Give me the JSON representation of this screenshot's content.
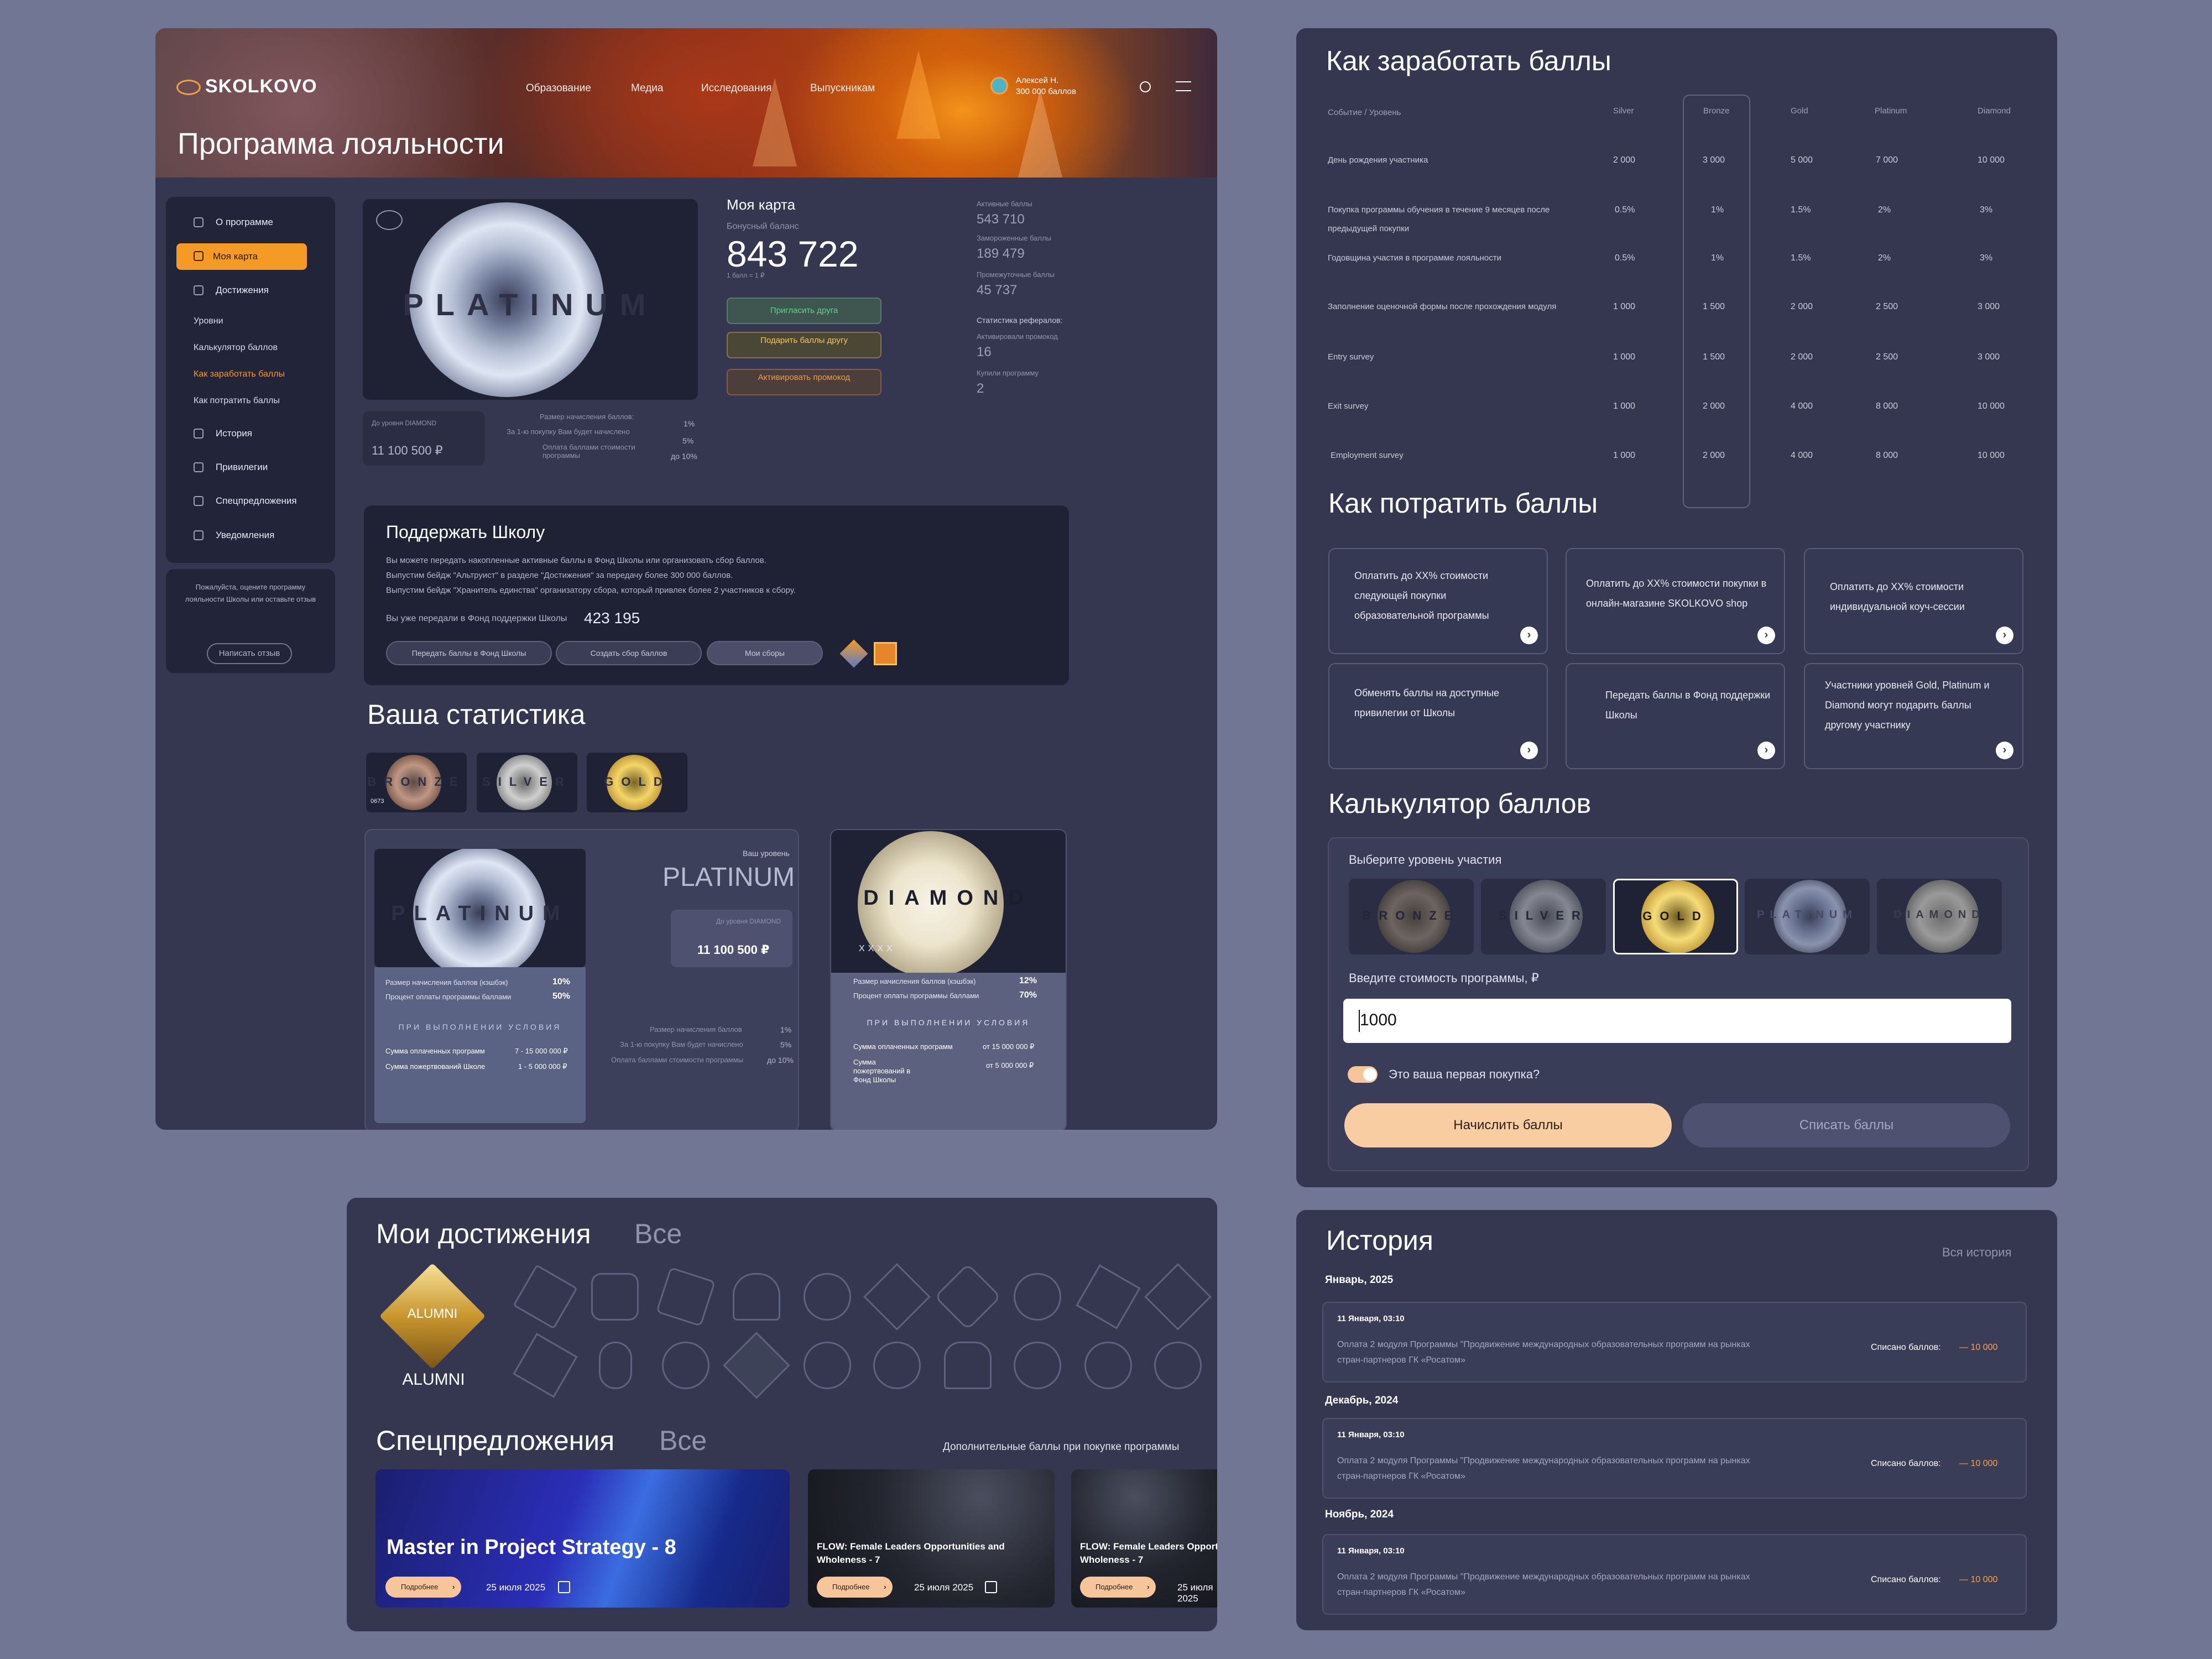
{
  "header": {
    "logo": "SKOLKOVO",
    "nav": [
      "Образование",
      "Медиа",
      "Исследования",
      "Выпускникам"
    ],
    "user_name": "Алексей Н.",
    "user_points": "300 000 баллов",
    "page_title": "Программа лояльности"
  },
  "sidebar": {
    "items": [
      "О программе",
      "Моя карта",
      "Достижения"
    ],
    "sub_items": [
      "Уровни",
      "Калькулятор баллов",
      "Как заработать баллы",
      "Как потратить баллы"
    ],
    "items2": [
      "История",
      "Привилегии",
      "Спецпредложения",
      "Уведомления"
    ],
    "feedback_text": "Пожалуйста, оцените программу лояльности Школы или оставьте отзыв",
    "feedback_button": "Написать отзыв"
  },
  "card": {
    "tier_word": "PLATINUM",
    "to_level_label": "До уровня DIAMOND",
    "to_level_value": "11 100 500 ₽",
    "rate_labels": [
      "Размер начисления баллов:",
      "За 1-ю покупку Вам будет начислено",
      "Оплата баллами стоимости программы"
    ],
    "rate_values": [
      "1%",
      "5%",
      "до 10%"
    ]
  },
  "my_card": {
    "title": "Моя карта",
    "balance_label": "Бонусный баланс",
    "balance": "843 722",
    "rate_note": "1 балл = 1 ₽",
    "btn_invite": "Пригласить друга",
    "btn_gift": "Подарить баллы другу",
    "btn_promo": "Активировать промокод",
    "active_label": "Активные баллы",
    "active_value": "543 710",
    "frozen_label": "Замороженные баллы",
    "frozen_value": "189 479",
    "expire_label": "Промежуточные баллы",
    "expire_value": "45 737",
    "ref_title": "Статистика рефералов:",
    "ref_promo_label": "Активировали промокод",
    "ref_promo_value": "16",
    "ref_bought_label": "Купили программу",
    "ref_bought_value": "2"
  },
  "support": {
    "title": "Поддержать Школу",
    "lines": [
      "Вы можете передать накопленные активные баллы в Фонд Школы или организовать сбор баллов.",
      "Выпустим бейдж \"Альтруист\" в разделе \"Достижения\" за передачу более 300 000 баллов.",
      "Выпустим бейдж \"Хранитель единства\" организатору сбора, который привлек более 2 участников к сбору."
    ],
    "transferred_label": "Вы уже передали в Фонд поддержки Школы",
    "transferred_value": "423 195",
    "btn_transfer": "Передать баллы в Фонд Школы",
    "btn_create": "Создать сбор баллов",
    "btn_my": "Мои сборы"
  },
  "stats": {
    "title": "Ваша статистика",
    "badges": [
      "BRONZE",
      "SILVER",
      "GOLD"
    ],
    "badge_number": "0673",
    "platinum_word": "PLATINUM",
    "diamond_word": "DIAMOND",
    "your_level_label": "Ваш уровень",
    "your_level": "PLATINUM",
    "to_level_label": "До уровня DIAMOND",
    "to_level_value": "11 100 500 ₽",
    "plat_rate_labels": [
      "Размер начисления баллов (кэшбэк)",
      "Процент оплаты программы баллами"
    ],
    "plat_rate_values": [
      "10%",
      "50%"
    ],
    "cond_title": "ПРИ ВЫПОЛНЕНИИ УСЛОВИЯ",
    "plat_cond_labels": [
      "Сумма оплаченных программ",
      "Сумма пожертвований Школе"
    ],
    "plat_cond_values": [
      "7 - 15 000 000 ₽",
      "1 - 5 000 000 ₽"
    ],
    "mid_labels": [
      "Размер начисления баллов",
      "За 1-ю покупку Вам будет начислено",
      "Оплата баллами стоимости программы"
    ],
    "mid_values": [
      "1%",
      "5%",
      "до 10%"
    ],
    "dia_number": "XXXX",
    "dia_rate_values": [
      "12%",
      "70%"
    ],
    "dia_cond_labels": [
      "Сумма оплаченных программ",
      "Сумма пожертвований в Фонд Школы"
    ],
    "dia_cond_values": [
      "от 15 000 000 ₽",
      "от 5 000 000 ₽"
    ]
  },
  "earn": {
    "title": "Как заработать баллы",
    "headers": [
      "Событие / Уровень",
      "Silver",
      "Bronze",
      "Gold",
      "Platinum",
      "Diamond"
    ],
    "rows": [
      {
        "label": "День рождения участника",
        "values": [
          "2 000",
          "3 000",
          "5 000",
          "7 000",
          "10 000"
        ]
      },
      {
        "label": "Покупка программы обучения в течение 9 месяцев после предыдущей покупки",
        "values": [
          "0.5%",
          "1%",
          "1.5%",
          "2%",
          "3%"
        ]
      },
      {
        "label": "Годовщина участия в программе лояльности",
        "values": [
          "0.5%",
          "1%",
          "1.5%",
          "2%",
          "3%"
        ]
      },
      {
        "label": "Заполнение оценочной формы после прохождения модуля",
        "values": [
          "1 000",
          "1 500",
          "2 000",
          "2 500",
          "3 000"
        ]
      },
      {
        "label": "Entry survey",
        "values": [
          "1 000",
          "1 500",
          "2 000",
          "2 500",
          "3 000"
        ]
      },
      {
        "label": "Exit survey",
        "values": [
          "1 000",
          "2 000",
          "4 000",
          "8 000",
          "10 000"
        ]
      },
      {
        "label": "Employment survey",
        "values": [
          "1 000",
          "2 000",
          "4 000",
          "8 000",
          "10 000"
        ]
      }
    ]
  },
  "spend": {
    "title": "Как потратить баллы",
    "cards": [
      "Оплатить до XX% стоимости следующей покупки образовательной программы",
      "Оплатить до XX% стоимости покупки в онлайн-магазине SKOLKOVO shop",
      "Оплатить до XX% стоимости индивидуальной коуч-сессии",
      "Обменять баллы на доступные привилегии от Школы",
      "Передать баллы в Фонд поддержки Школы",
      "Участники уровней Gold, Platinum и Diamond могут подарить баллы другому участнику"
    ]
  },
  "calculator": {
    "title": "Калькулятор баллов",
    "level_label": "Выберите уровень участия",
    "levels": [
      "BRONZE",
      "SILVER",
      "GOLD",
      "PLATINUM",
      "DIAMOND"
    ],
    "selected_level": "GOLD",
    "cost_label": "Введите стоимость программы, ₽",
    "cost_value": "1000",
    "first_purchase": "Это ваша первая покупка?",
    "btn_accrue": "Начислить баллы",
    "btn_spend": "Списать баллы"
  },
  "achievements": {
    "title": "Мои достижения",
    "all_link": "Все",
    "featured": "ALUMNI",
    "featured_caption": "ALUMNI"
  },
  "offers": {
    "title": "Спецпредложения",
    "all_link": "Все",
    "note": "Дополнительные баллы при покупке программы",
    "items": [
      {
        "title": "Master in Project Strategy - 8",
        "more": "Подробнее",
        "date": "25 июля 2025"
      },
      {
        "title": "FLOW: Female Leaders Opportunities and Wholeness - 7",
        "more": "Подробнее",
        "date": "25 июля 2025"
      },
      {
        "title": "FLOW: Female Leaders Opportunities and Wholeness - 7",
        "more": "Подробнее",
        "date": "25 июля 2025"
      }
    ]
  },
  "history": {
    "title": "История",
    "all_link": "Вся история",
    "groups": [
      {
        "month": "Январь, 2025",
        "date": "11 Января, 03:10",
        "desc": "Оплата 2 модуля Программы \"Продвижение международных образовательных программ на рынках стран-партнеров ГК «Росатом»",
        "label": "Списано баллов:",
        "amount": "— 10 000"
      },
      {
        "month": "Декабрь, 2024",
        "date": "11 Января, 03:10",
        "desc": "Оплата 2 модуля Программы \"Продвижение международных образовательных программ на рынках стран-партнеров ГК «Росатом»",
        "label": "Списано баллов:",
        "amount": "— 10 000"
      },
      {
        "month": "Ноябрь, 2024",
        "date": "11 Января, 03:10",
        "desc": "Оплата 2 модуля Программы \"Продвижение международных образовательных программ на рынках стран-партнеров ГК «Росатом»",
        "label": "Списано баллов:",
        "amount": "— 10 000"
      }
    ]
  },
  "colors": {
    "accent": "#f59a25",
    "panel": "#34374f",
    "dark": "#1f2235",
    "peach": "#f6c69a"
  }
}
